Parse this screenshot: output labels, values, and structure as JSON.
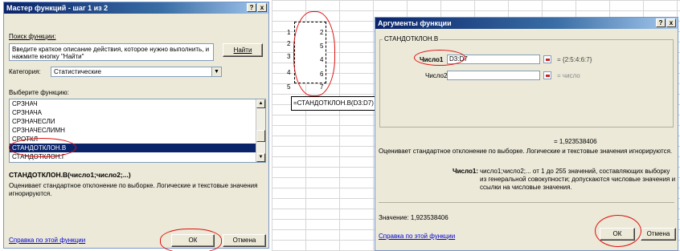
{
  "spreadsheet": {
    "row_numbers": [
      "1",
      "2",
      "3",
      "4",
      "5"
    ],
    "values": [
      "2",
      "5",
      "4",
      "6",
      "7"
    ],
    "formula": "=СТАНДОТКЛОН.В(D3:D7)"
  },
  "dialog1": {
    "title": "Мастер функций - шаг 1 из 2",
    "search_label": "Поиск функции:",
    "search_text": "Введите краткое описание действия, которое нужно выполнить, и нажмите кнопку \"Найти\"",
    "find_button": "Найти",
    "category_label": "Категория:",
    "category_value": "Статистические",
    "select_label": "Выберите функцию:",
    "functions": [
      "СРЗНАЧ",
      "СРЗНАЧА",
      "СРЗНАЧЕСЛИ",
      "СРЗНАЧЕСЛИМН",
      "СРОТКЛ",
      "СТАНДОТКЛОН.В",
      "СТАНДОТКЛОН.Г"
    ],
    "selected_index": 5,
    "signature": "СТАНДОТКЛОН.В(число1;число2;...)",
    "description": "Оценивает стандартное отклонение по выборке. Логические и текстовые значения игнорируются.",
    "help_link": "Справка по этой функции",
    "ok_button": "ОК",
    "cancel_button": "Отмена"
  },
  "dialog2": {
    "title": "Аргументы функции",
    "group_title": "СТАНДОТКЛОН.В",
    "arg1_label": "Число1",
    "arg1_value": "D3:D7",
    "arg1_result": "= {2:5:4:6:7}",
    "arg2_label": "Число2",
    "arg2_value": "",
    "arg2_result": "= число",
    "formula_result": "= 1,923538406",
    "description": "Оценивает стандартное отклонение по выборке. Логические и текстовые значения игнорируются.",
    "arg_help_label": "Число1:",
    "arg_help_text": "число1;число2;... от 1 до 255 значений, составляющих выборку из генеральной совокупности; допускаются числовые значения и ссылки на числовые значения.",
    "value_line": "Значение: 1,923538406",
    "help_link": "Справка по этой функции",
    "ok_button": "ОК",
    "cancel_button": "Отмена"
  },
  "titlebar_buttons": {
    "help": "?",
    "close": "x"
  },
  "colors": {
    "dialog_bg": "#ece9d8",
    "selection": "#0a246a",
    "annotation": "#e01010",
    "link": "#0000cc"
  }
}
